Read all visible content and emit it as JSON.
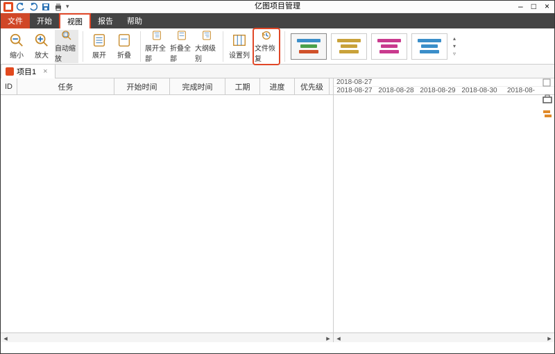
{
  "app": {
    "title": "亿图项目管理"
  },
  "winctrl": {
    "min": "–",
    "max": "□",
    "close": "×"
  },
  "menutabs": {
    "file": "文件",
    "start": "开始",
    "view": "视图",
    "report": "报告",
    "help": "帮助"
  },
  "ribbon": {
    "zoom_out": "缩小",
    "zoom_in": "放大",
    "auto_zoom": "自动缩放",
    "expand": "展开",
    "collapse": "折叠",
    "expand_all": "展开全部",
    "collapse_all": "折叠全部",
    "outline_level": "大纲级别",
    "set_columns": "设置列",
    "file_restore": "文件恢复"
  },
  "doctab": {
    "project1": "项目1",
    "close": "×"
  },
  "columns": {
    "id": "ID",
    "task": "任务",
    "start": "开始时间",
    "finish": "完成时间",
    "duration": "工期",
    "progress": "进度",
    "priority": "优先级"
  },
  "timeline": {
    "header": "2018-08-27",
    "dates": [
      "2018-08-27",
      "2018-08-28",
      "2018-08-29",
      "2018-08-30",
      "2018-08-"
    ]
  }
}
